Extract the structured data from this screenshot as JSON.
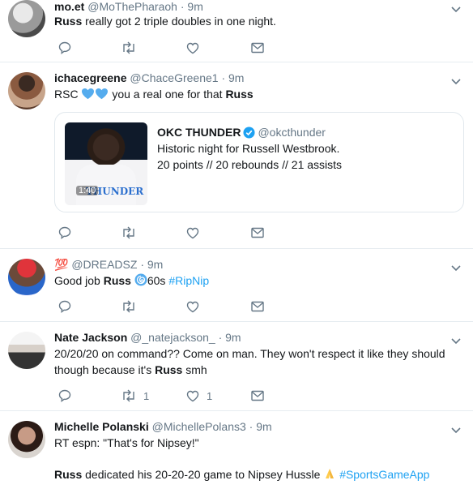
{
  "tweets": [
    {
      "name": "mo.et",
      "handle": "@MoThePharaoh",
      "time": "9m",
      "text_bold": "Russ",
      "text_rest": " really got 2 triple doubles in one night."
    },
    {
      "name": "ichacegreene",
      "handle": "@ChaceGreene1",
      "time": "9m",
      "text_pre": "RSC ",
      "text_mid": " you a real one for that ",
      "text_bold": "Russ",
      "card": {
        "name": "OKC THUNDER",
        "handle": "@okcthunder",
        "line1": "Historic night for Russell Westbrook.",
        "line2": "20 points // 20 rebounds // 21 assists",
        "video_duration": "1:40",
        "jersey_text": "THUNDER"
      }
    },
    {
      "name_emoji": "💯",
      "handle": "@DREADSZ",
      "time": "9m",
      "text_pre": "Good job ",
      "text_bold": "Russ",
      "text_after": "60s ",
      "hashtag": "#RipNip"
    },
    {
      "name": "Nate Jackson",
      "handle": "@_natejackson_",
      "time": "9m",
      "line1": "20/20/20 on command?? Come on man. They won't respect it like they should",
      "line2_pre": "though because it's ",
      "text_bold": "Russ",
      "line2_post": " smh",
      "retweets": "1",
      "likes": "1"
    },
    {
      "name": "Michelle Polanski",
      "handle": "@MichellePolans3",
      "time": "9m",
      "line1": "RT espn: \"That's for Nipsey!\"",
      "text_bold": "Russ",
      "line2": " dedicated his 20-20-20 game to Nipsey Hussle ",
      "hashtag": "#SportsGameApp"
    }
  ],
  "sep": "·",
  "colors": {
    "accent": "#1da1f2",
    "muted": "#657786",
    "border": "#e6ecf0"
  }
}
